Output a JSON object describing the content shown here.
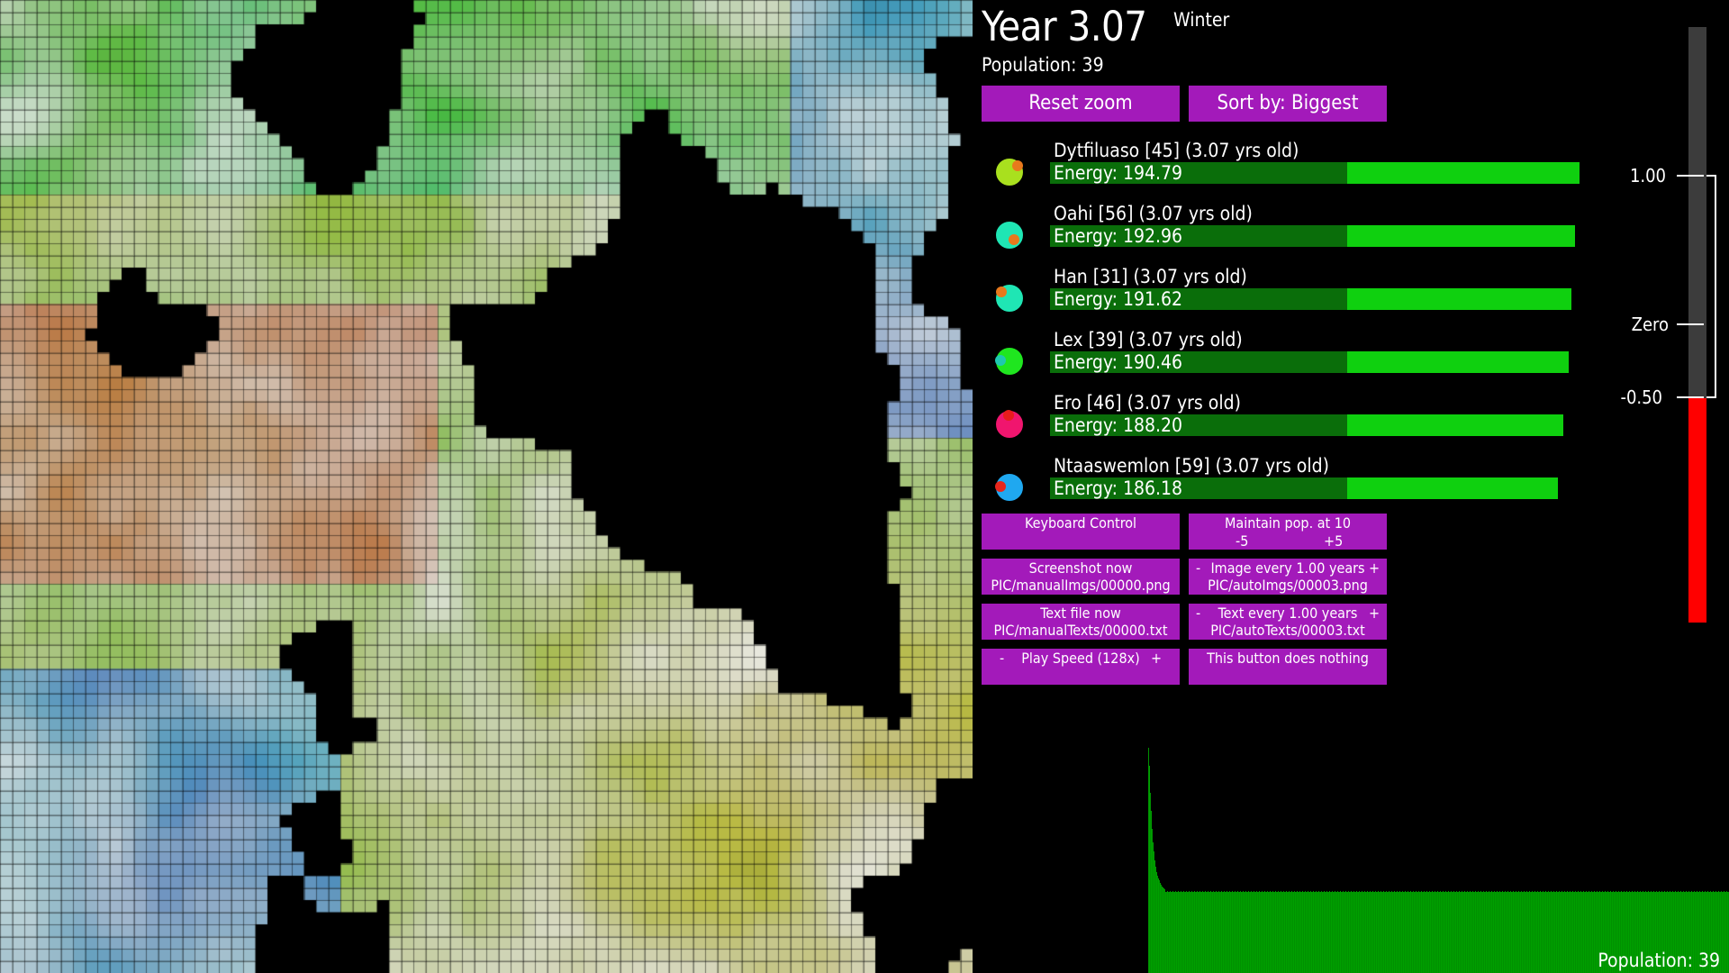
{
  "header": {
    "year": "Year 3.07",
    "season": "Winter",
    "population": "Population: 39"
  },
  "buttons": {
    "reset_zoom": "Reset zoom",
    "sort": "Sort by: Biggest",
    "keyboard": "Keyboard Control",
    "maintain_l1": "Maintain pop. at 10",
    "maintain_minus": "-5",
    "maintain_plus": "+5",
    "screenshot_l1": "Screenshot now",
    "screenshot_l2": "PIC/manualImgs/00000.png",
    "image_every_l1": "Image every 1.00 years",
    "image_every_l2": "PIC/autoImgs/00003.png",
    "textfile_l1": "Text file now",
    "textfile_l2": "PIC/manualTexts/00000.txt",
    "text_every_l1": "Text every 1.00 years",
    "text_every_l2": "PIC/autoTexts/00003.txt",
    "play_speed": "Play Speed (128x)",
    "nothing": "This button does nothing",
    "minus": "-",
    "plus": "+"
  },
  "creatures": [
    {
      "name": "Dytfiluaso [45] (3.07 yrs old)",
      "energy": "Energy: 194.79",
      "energy_value": 194.79,
      "body": "#a9e01e",
      "mouth": "#e8791c",
      "mouth_pos": "right"
    },
    {
      "name": "Oahi [56] (3.07 yrs old)",
      "energy": "Energy: 192.96",
      "energy_value": 192.96,
      "body": "#1fe6b4",
      "mouth": "#e8791c",
      "mouth_pos": "bottom-right"
    },
    {
      "name": "Han [31] (3.07 yrs old)",
      "energy": "Energy: 191.62",
      "energy_value": 191.62,
      "body": "#1fe6b4",
      "mouth": "#e8791c",
      "mouth_pos": "top-left"
    },
    {
      "name": "Lex [39] (3.07 yrs old)",
      "energy": "Energy: 190.46",
      "energy_value": 190.46,
      "body": "#1fe61f",
      "mouth": "#1fc8b0",
      "mouth_pos": "left"
    },
    {
      "name": "Ero [46] (3.07 yrs old)",
      "energy": "Energy: 188.20",
      "energy_value": 188.2,
      "body": "#f0156e",
      "mouth": "#e81c1c",
      "mouth_pos": "top"
    },
    {
      "name": "Ntaaswemlon [59] (3.07 yrs old)",
      "energy": "Energy: 186.18",
      "energy_value": 186.18,
      "body": "#1fa8f0",
      "mouth": "#e8261c",
      "mouth_pos": "left"
    }
  ],
  "thermometer": {
    "label_high": "1.00",
    "label_zero": "Zero",
    "label_low": "-0.50",
    "value": -0.5,
    "bg_color": "#3c3c3c",
    "fill_color": "#ff0000"
  },
  "graph": {
    "label": "Population: 39",
    "color": "#00a000"
  },
  "colors": {
    "button": "#a31aba",
    "energy_dark": "#0a6e0a",
    "energy_bright": "#0fd00f"
  }
}
